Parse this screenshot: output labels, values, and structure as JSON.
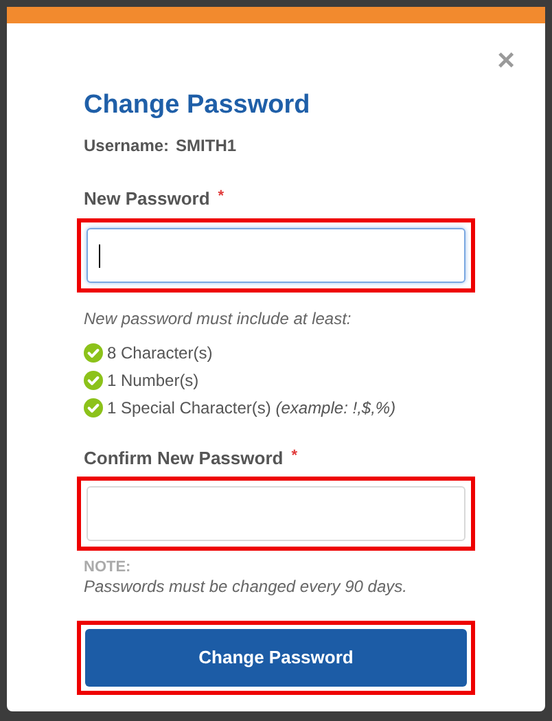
{
  "dialog": {
    "title": "Change Password",
    "close": "×"
  },
  "username": {
    "label": "Username:",
    "value": "SMITH1"
  },
  "fields": [
    {
      "label": "New Password",
      "required_mark": "*",
      "focused": true,
      "highlighted": true
    },
    {
      "label": "Confirm New Password",
      "required_mark": "*",
      "focused": false,
      "highlighted": true
    }
  ],
  "rules": {
    "intro": "New password must include at least:",
    "items": [
      {
        "text": "8 Character(s)",
        "met": true
      },
      {
        "text": "1 Number(s)",
        "met": true
      },
      {
        "text": "1 Special Character(s) *(example: !,$,%)*",
        "met": true
      }
    ]
  },
  "note": {
    "heading": "NOTE:",
    "text": "Passwords must be changed every 90 days."
  },
  "submit": {
    "label": "Change Password",
    "highlighted": true
  }
}
